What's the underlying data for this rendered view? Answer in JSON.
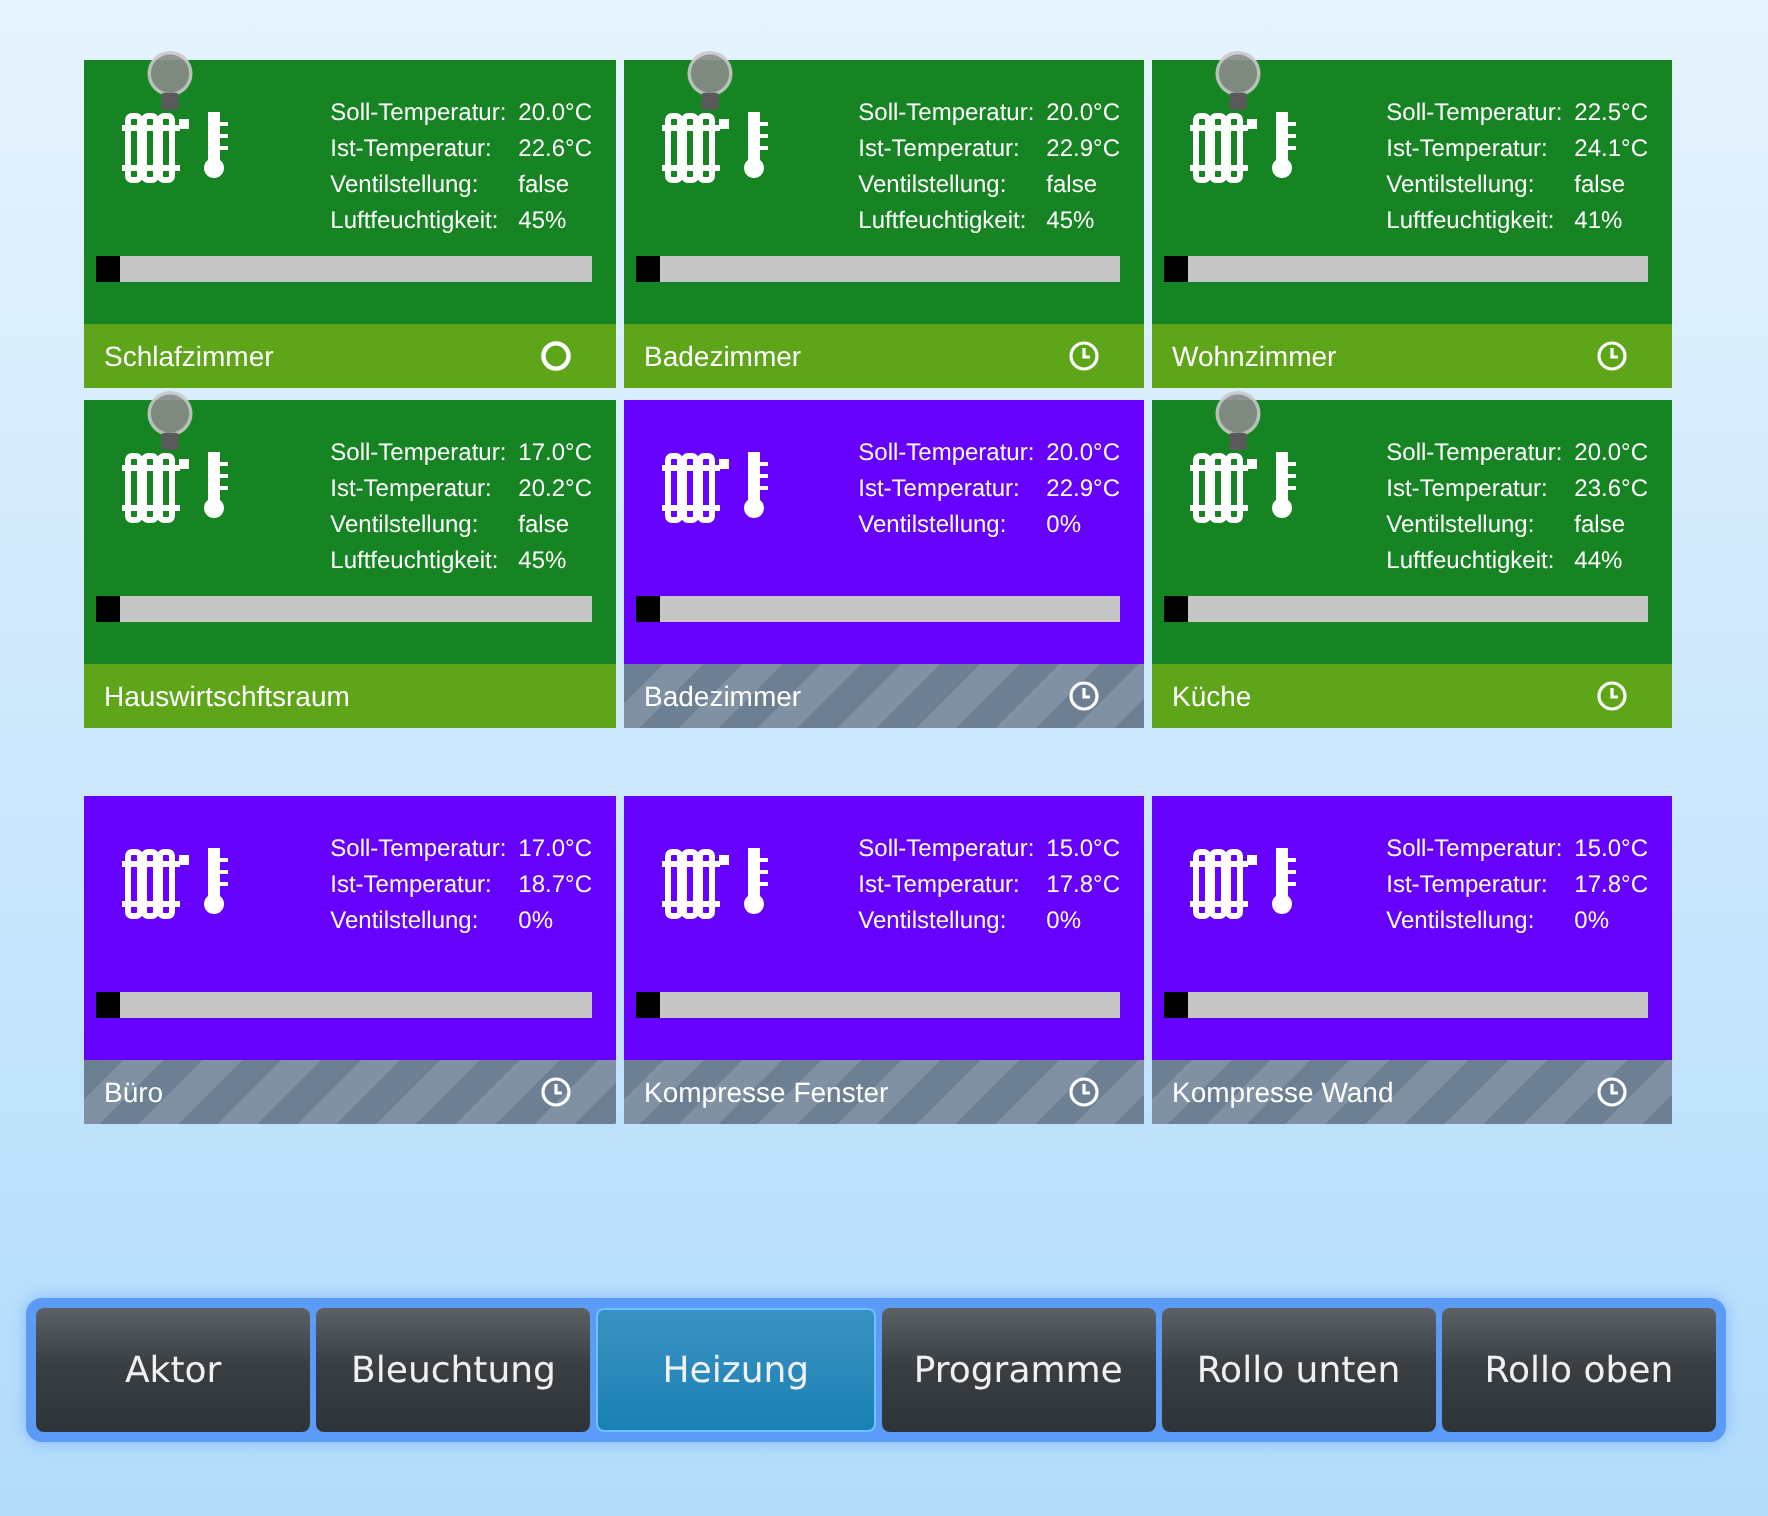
{
  "rooms": [
    {
      "name": "Schlafzimmer",
      "kind": "green",
      "bulb": true,
      "clock": false,
      "ring": true,
      "level": 0.05,
      "stats": [
        {
          "label": "Soll-Temperatur:",
          "value": "20.0°C"
        },
        {
          "label": "Ist-Temperatur:",
          "value": "22.6°C"
        },
        {
          "label": "Ventilstellung:",
          "value": "false"
        },
        {
          "label": "Luftfeuchtigkeit:",
          "value": "45%"
        }
      ]
    },
    {
      "name": "Badezimmer",
      "kind": "green",
      "bulb": true,
      "clock": true,
      "ring": false,
      "level": 0.05,
      "stats": [
        {
          "label": "Soll-Temperatur:",
          "value": "20.0°C"
        },
        {
          "label": "Ist-Temperatur:",
          "value": "22.9°C"
        },
        {
          "label": "Ventilstellung:",
          "value": "false"
        },
        {
          "label": "Luftfeuchtigkeit:",
          "value": "45%"
        }
      ]
    },
    {
      "name": "Wohnzimmer",
      "kind": "green",
      "bulb": true,
      "clock": true,
      "ring": false,
      "level": 0.05,
      "stats": [
        {
          "label": "Soll-Temperatur:",
          "value": "22.5°C"
        },
        {
          "label": "Ist-Temperatur:",
          "value": "24.1°C"
        },
        {
          "label": "Ventilstellung:",
          "value": "false"
        },
        {
          "label": "Luftfeuchtigkeit:",
          "value": "41%"
        }
      ]
    },
    {
      "name": "Hauswirtschftsraum",
      "kind": "green",
      "bulb": true,
      "clock": false,
      "ring": false,
      "level": 0.05,
      "stats": [
        {
          "label": "Soll-Temperatur:",
          "value": "17.0°C"
        },
        {
          "label": "Ist-Temperatur:",
          "value": "20.2°C"
        },
        {
          "label": "Ventilstellung:",
          "value": "false"
        },
        {
          "label": "Luftfeuchtigkeit:",
          "value": "45%"
        }
      ]
    },
    {
      "name": "Badezimmer",
      "kind": "purple",
      "bulb": false,
      "clock": true,
      "ring": false,
      "level": 0.05,
      "stats": [
        {
          "label": "Soll-Temperatur:",
          "value": "20.0°C"
        },
        {
          "label": "Ist-Temperatur:",
          "value": "22.9°C"
        },
        {
          "label": "Ventilstellung:",
          "value": "0%"
        }
      ]
    },
    {
      "name": "Küche",
      "kind": "green",
      "bulb": true,
      "clock": true,
      "ring": false,
      "level": 0.05,
      "stats": [
        {
          "label": "Soll-Temperatur:",
          "value": "20.0°C"
        },
        {
          "label": "Ist-Temperatur:",
          "value": "23.6°C"
        },
        {
          "label": "Ventilstellung:",
          "value": "false"
        },
        {
          "label": "Luftfeuchtigkeit:",
          "value": "44%"
        }
      ]
    },
    {
      "name": "Büro",
      "kind": "purple",
      "bulb": false,
      "clock": true,
      "ring": false,
      "level": 0.05,
      "stats": [
        {
          "label": "Soll-Temperatur:",
          "value": "17.0°C"
        },
        {
          "label": "Ist-Temperatur:",
          "value": "18.7°C"
        },
        {
          "label": "Ventilstellung:",
          "value": "0%"
        }
      ]
    },
    {
      "name": "Kompresse Fenster",
      "kind": "purple",
      "bulb": false,
      "clock": true,
      "ring": false,
      "level": 0.05,
      "stats": [
        {
          "label": "Soll-Temperatur:",
          "value": "15.0°C"
        },
        {
          "label": "Ist-Temperatur:",
          "value": "17.8°C"
        },
        {
          "label": "Ventilstellung:",
          "value": "0%"
        }
      ]
    },
    {
      "name": "Kompresse Wand",
      "kind": "purple",
      "bulb": false,
      "clock": true,
      "ring": false,
      "level": 0.05,
      "stats": [
        {
          "label": "Soll-Temperatur:",
          "value": "15.0°C"
        },
        {
          "label": "Ist-Temperatur:",
          "value": "17.8°C"
        },
        {
          "label": "Ventilstellung:",
          "value": "0%"
        }
      ]
    }
  ],
  "nav": [
    {
      "label": "Aktor",
      "selected": false
    },
    {
      "label": "Bleuchtung",
      "selected": false
    },
    {
      "label": "Heizung",
      "selected": true
    },
    {
      "label": "Programme",
      "selected": false
    },
    {
      "label": "Rollo unten",
      "selected": false
    },
    {
      "label": "Rollo oben",
      "selected": false
    }
  ]
}
